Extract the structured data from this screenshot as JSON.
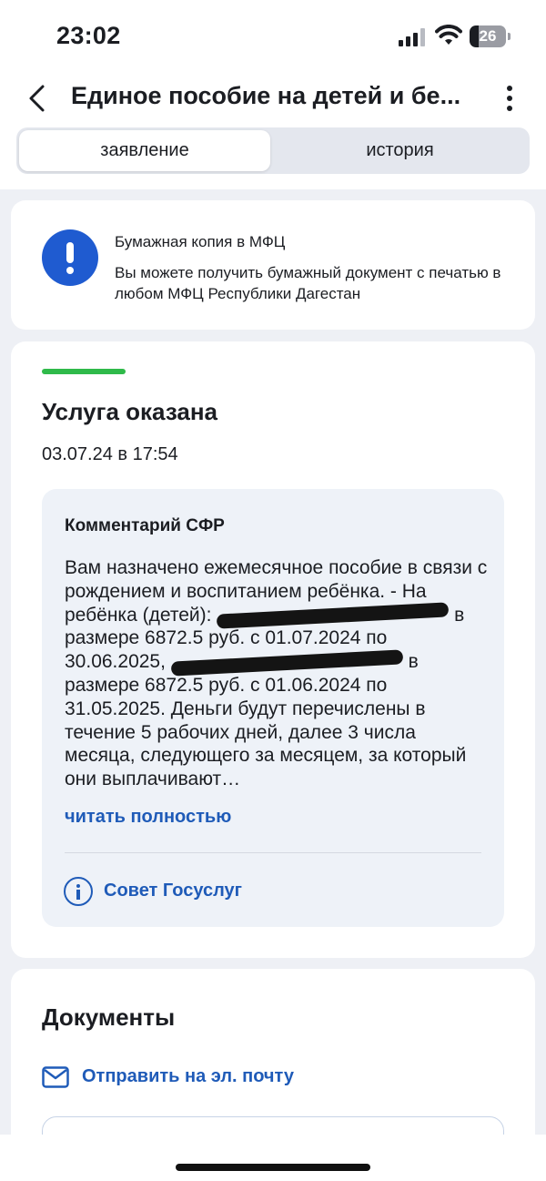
{
  "status_bar": {
    "time": "23:02",
    "battery_level": "26"
  },
  "header": {
    "title": "Единое пособие на детей и бе...",
    "back_icon": "chevron-left-icon",
    "menu_icon": "more-vertical-icon"
  },
  "tabs": [
    {
      "label": "заявление",
      "active": true
    },
    {
      "label": "история",
      "active": false
    }
  ],
  "mfc_notice": {
    "icon": "alert-icon",
    "title": "Бумажная копия в МФЦ",
    "text": "Вы можете получить бумажный документ с печатью в любом МФЦ Республики Дагестан"
  },
  "status": {
    "title": "Услуга оказана",
    "date": "03.07.24 в 17:54",
    "progress_color": "#2fba4a"
  },
  "comment": {
    "title": "Комментарий СФР",
    "line1": "Вам назначено ежемесячное пособие в связи с рождением и воспитанием ребёнка. - На ребёнка (детей): ",
    "line2": " в размере 6872.5 руб. с 01.07.2024 по 30.06.2025, ",
    "line3": " в размере 6872.5 руб. с 01.06.2024 по 31.05.2025. Деньги будут перечислены в течение 5 рабочих дней, далее 3 числа месяца, следующего за месяцем, за который они выплачивают…",
    "read_more": "читать полностью",
    "advice_label": "Совет Госуслуг"
  },
  "documents": {
    "title": "Документы",
    "email_action": "Отправить на эл. почту"
  },
  "colors": {
    "accent": "#1f5bb8",
    "alert": "#1f5bd0",
    "background": "#eef0f5"
  }
}
